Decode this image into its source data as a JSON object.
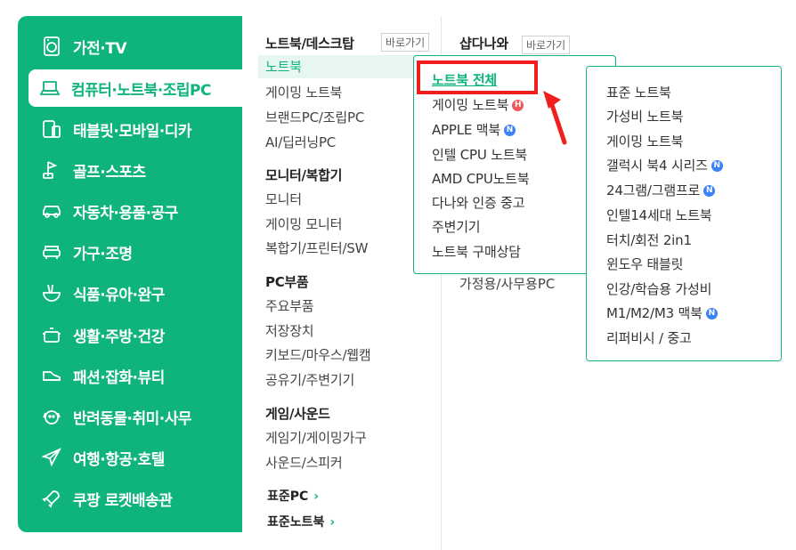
{
  "sidebar": {
    "items": [
      {
        "label": "가전·TV",
        "icon": "washing-machine-icon"
      },
      {
        "label": "컴퓨터·노트북·조립PC",
        "icon": "laptop-icon",
        "active": true
      },
      {
        "label": "태블릿·모바일·디카",
        "icon": "tablet-phone-icon"
      },
      {
        "label": "골프·스포츠",
        "icon": "golf-icon"
      },
      {
        "label": "자동차·용품·공구",
        "icon": "car-icon"
      },
      {
        "label": "가구·조명",
        "icon": "sofa-icon"
      },
      {
        "label": "식품·유아·완구",
        "icon": "noodle-bowl-icon"
      },
      {
        "label": "생활·주방·건강",
        "icon": "pot-icon"
      },
      {
        "label": "패션·잡화·뷰티",
        "icon": "sneaker-icon"
      },
      {
        "label": "반려동물·취미·사무",
        "icon": "dog-icon"
      },
      {
        "label": "여행·항공·호텔",
        "icon": "airplane-icon"
      },
      {
        "label": "쿠팡 로켓배송관",
        "icon": "rocket-icon"
      }
    ]
  },
  "column2": {
    "group1_title": "노트북/데스크탑",
    "goto_label": "바로가기",
    "group1_items": [
      "노트북",
      "게이밍 노트북",
      "브랜드PC/조립PC",
      "AI/딥러닝PC"
    ],
    "group2_title": "모니터/복합기",
    "group2_items": [
      "모니터",
      "게이밍 모니터",
      "복합기/프린터/SW"
    ],
    "group3_title": "PC부품",
    "group3_items": [
      "주요부품",
      "저장장치",
      "키보드/마우스/웹캠",
      "공유기/주변기기"
    ],
    "group4_title": "게임/사운드",
    "group4_items": [
      "게임기/게이밍가구",
      "사운드/스피커"
    ],
    "link1": "표준PC",
    "link2": "표준노트북"
  },
  "column3": {
    "title": "샵다나와",
    "goto_label": "바로가기",
    "tail_item": "가정용/사무용PC"
  },
  "popup1": {
    "items": [
      "노트북 전체",
      "게이밍 노트북",
      "APPLE 맥북",
      "인텔 CPU 노트북",
      "AMD CPU노트북",
      "다나와 인증 중고",
      "주변기기",
      "노트북 구매상담"
    ],
    "badge_h": "H",
    "badge_n": "N"
  },
  "popup2": {
    "items": [
      "표준 노트북",
      "가성비 노트북",
      "게이밍 노트북",
      "갤럭시 북4 시리즈",
      "24그램/그램프로",
      "인텔14세대 노트북",
      "터치/회전 2in1",
      "윈도우 태블릿",
      "인강/학습용 가성비",
      "M1/M2/M3 맥북",
      "리퍼비시 / 중고"
    ]
  },
  "colors": {
    "brand": "#0fb37e",
    "highlight": "#f21d1d"
  }
}
